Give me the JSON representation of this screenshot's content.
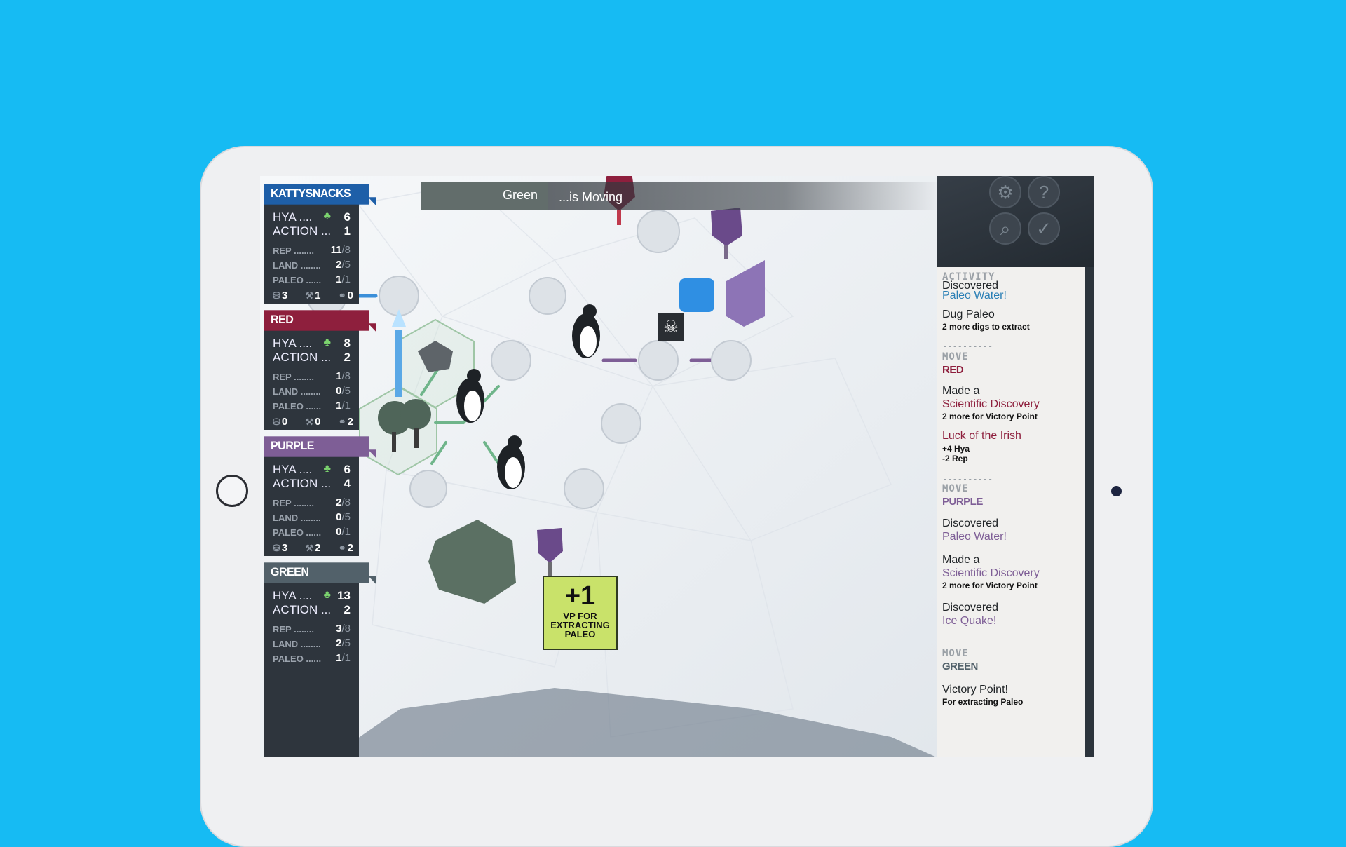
{
  "topbar": {
    "player": "Green",
    "status": "...is Moving"
  },
  "colors": {
    "blue": "#1e5fa8",
    "red": "#8e1f3d",
    "purple": "#7e5e96",
    "green": "#52616a",
    "background": "#16bbf3"
  },
  "players": [
    {
      "name": "KATTYSNACKS",
      "color": "#1e5fa8",
      "hya_label": "HYA ....",
      "hya": "6",
      "action_label": "ACTION ...",
      "action": "1",
      "rep_label": "REP ........",
      "rep": "11",
      "rep_max": "/8",
      "land_label": "LAND ........",
      "land": "2",
      "land_max": "/5",
      "paleo_label": "PALEO ......",
      "paleo": "1",
      "paleo_max": "/1",
      "res1": "3",
      "res2": "1",
      "res3": "0"
    },
    {
      "name": "RED",
      "color": "#8e1f3d",
      "hya_label": "HYA ....",
      "hya": "8",
      "action_label": "ACTION ...",
      "action": "2",
      "rep_label": "REP ........",
      "rep": "1",
      "rep_max": "/8",
      "land_label": "LAND ........",
      "land": "0",
      "land_max": "/5",
      "paleo_label": "PALEO ......",
      "paleo": "1",
      "paleo_max": "/1",
      "res1": "0",
      "res2": "0",
      "res3": "2"
    },
    {
      "name": "PURPLE",
      "color": "#7e5e96",
      "hya_label": "HYA ....",
      "hya": "6",
      "action_label": "ACTION ...",
      "action": "4",
      "rep_label": "REP ........",
      "rep": "2",
      "rep_max": "/8",
      "land_label": "LAND ........",
      "land": "0",
      "land_max": "/5",
      "paleo_label": "PALEO ......",
      "paleo": "0",
      "paleo_max": "/1",
      "res1": "3",
      "res2": "2",
      "res3": "2"
    },
    {
      "name": "GREEN",
      "color": "#52616a",
      "hya_label": "HYA ....",
      "hya": "13",
      "action_label": "ACTION ...",
      "action": "2",
      "rep_label": "REP ........",
      "rep": "3",
      "rep_max": "/8",
      "land_label": "LAND ........",
      "land": "2",
      "land_max": "/5",
      "paleo_label": "PALEO ......",
      "paleo": "1",
      "paleo_max": "/1",
      "res1": "",
      "res2": "",
      "res3": ""
    }
  ],
  "activity": {
    "title": "ACTIVITY",
    "cut_top": "Discovered",
    "e1_link": "Paleo Water!",
    "e2_head": "Dug Paleo",
    "e2_sub": "2 more digs to extract",
    "sep": "----------",
    "move_label": "MOVE",
    "move1_player": "RED",
    "e3_head": "Made a",
    "e3_link": "Scientific Discovery",
    "e3_sub": "2 more for Victory Point",
    "e4_link": "Luck of the Irish",
    "e4_sub1": "+4 Hya",
    "e4_sub2": "-2 Rep",
    "move2_player": "PURPLE",
    "e5_head": "Discovered",
    "e5_link": "Paleo Water!",
    "e6_head": "Made a",
    "e6_link": "Scientific Discovery",
    "e6_sub": "2 more for Victory Point",
    "e7_head": "Discovered",
    "e7_link": "Ice Quake!",
    "move3_player": "GREEN",
    "e8_head": "Victory Point!",
    "e8_sub": "For extracting Paleo"
  },
  "vp_card": {
    "value": "+1",
    "text1": "VP FOR",
    "text2": "EXTRACTING",
    "text3": "PALEO"
  },
  "icons": {
    "settings": "gear-icon",
    "help": "question-icon",
    "zoom": "magnifier-icon",
    "confirm": "check-icon",
    "hazard": "skull-icon"
  }
}
